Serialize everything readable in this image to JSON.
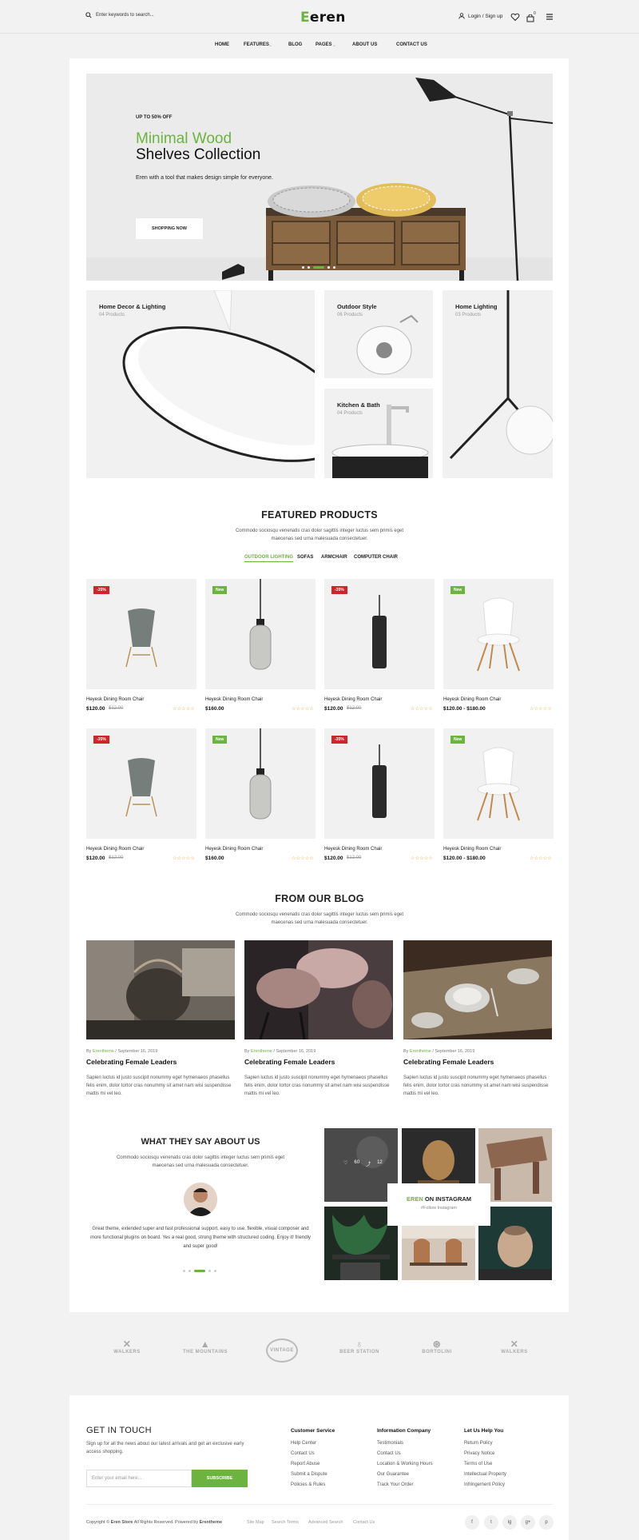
{
  "header": {
    "search_placeholder": "Enter keywords to search...",
    "logo": "eren",
    "logo_initial": "E",
    "login": "Login / Sign up",
    "cart_count": "0"
  },
  "nav": [
    "HOME",
    "FEATURES",
    "BLOG",
    "PAGES",
    "ABOUT US",
    "CONTACT US"
  ],
  "hero": {
    "kicker": "UP TO 50% OFF",
    "title_line1": "Minimal Wood",
    "title_line2": "Shelves Collection",
    "subtitle": "Eren with a tool that makes design simple for everyone.",
    "button": "SHOPPING NOW",
    "slides_active": 3
  },
  "categories": [
    {
      "title": "Home Decor & Lighting",
      "count": "04 Products"
    },
    {
      "title": "Outdoor Style",
      "count": "06 Products"
    },
    {
      "title": "Home Lighting",
      "count": "03 Products"
    },
    {
      "title": "Kitchen & Bath",
      "count": "04 Products"
    }
  ],
  "featured": {
    "title": "FEATURED PRODUCTS",
    "subtitle": "Commodo sociosqu venenatis cras dolor sagittis integer luctus sem primis eget maecenas sed urna malesuada consectetuer.",
    "tabs": [
      "OUTDOOR LIGHTING",
      "SOFAS",
      "ARMCHAIR",
      "COMPUTER CHAIR"
    ],
    "products": [
      {
        "name": "Heyesk Dining Room Chair",
        "price": "$120.00",
        "old": "$12.00",
        "badge": "-35%"
      },
      {
        "name": "Heyesk Dining Room Chair",
        "price": "$160.00",
        "old": "",
        "badge": "New"
      },
      {
        "name": "Heyesk Dining Room Chair",
        "price": "$120.00",
        "old": "$12.00",
        "badge": "-35%"
      },
      {
        "name": "Heyesk Dining Room Chair",
        "price": "$120.00 - $180.00",
        "old": "",
        "badge": "New"
      },
      {
        "name": "Heyesk Dining Room Chair",
        "price": "$120.00",
        "old": "$12.00",
        "badge": "-35%"
      },
      {
        "name": "Heyesk Dining Room Chair",
        "price": "$160.00",
        "old": "",
        "badge": "New"
      },
      {
        "name": "Heyesk Dining Room Chair",
        "price": "$120.00",
        "old": "$12.00",
        "badge": "-35%"
      },
      {
        "name": "Heyesk Dining Room Chair",
        "price": "$120.00 - $180.00",
        "old": "",
        "badge": "New"
      }
    ],
    "stars": "☆☆☆☆☆"
  },
  "blog": {
    "title": "FROM OUR BLOG",
    "subtitle": "Commodo sociosqu venenatis cras dolor sagittis integer luctus sem primis eget maecenas sed urna malesuada consectetuer.",
    "posts": [
      {
        "by": "By ",
        "author": "Erentheme",
        "date": " / September 16, 2019",
        "title": "Celebrating Female Leaders",
        "excerpt": "Sapien luctus id justo suscipit nonummy eget hymenaeos phasellus felis enim, dolor tortor cras nonummy sit amet nam wisi suspendisse mattis mi vel leo."
      },
      {
        "by": "By ",
        "author": "Erentheme",
        "date": " / September 16, 2019",
        "title": "Celebrating Female Leaders",
        "excerpt": "Sapien luctus id justo suscipit nonummy eget hymenaeos phasellus felis enim, dolor tortor cras nonummy sit amet nam wisi suspendisse mattis mi vel leo."
      },
      {
        "by": "By ",
        "author": "Erentheme",
        "date": " / September 16, 2019",
        "title": "Celebrating Female Leaders",
        "excerpt": "Sapien luctus id justo suscipit nonummy eget hymenaeos phasellus felis enim, dolor tortor cras nonummy sit amet nam wisi suspendisse mattis mi vel leo."
      }
    ]
  },
  "testimonial": {
    "title": "WHAT THEY SAY ABOUT US",
    "subtitle": "Commodo sociosqu venenatis cras dolor sagittis integer luctus sem primis eget maecenas sed urna malesuada consectetuer.",
    "quote": "Great theme, extended super and fast professional support, easy to use, flexible, visual composer and more functional plugins on board. Yes a real good, strong theme with structured coding. Enjoy it! friendly and super good!"
  },
  "instagram": {
    "brand": "EREN",
    "title_rest": " ON INSTAGRAM",
    "follow": "#Follow Instagram",
    "likes": "60",
    "shares": "12"
  },
  "brands": [
    "WALKERS",
    "THE MOUNTAINS",
    "VINTAGE",
    "BEER STATION",
    "BORTOLINI",
    "WALKERS"
  ],
  "footer": {
    "get_in_touch": "GET IN TOUCH",
    "signup_text": "Sign up for all the news about our latest arrivals and get an exclusive early access shopping.",
    "email_placeholder": "Enter your email here...",
    "subscribe": "SUBSCRIBE",
    "columns": [
      {
        "title": "Customer Service",
        "links": [
          "Help Center",
          "Contact Us",
          "Report Abuse",
          "Submit a Dispute",
          "Policies & Rules"
        ]
      },
      {
        "title": "Information Company",
        "links": [
          "Testimonials",
          "Contact Us",
          "Location & Working Hours",
          "Our Guarantee",
          "Track Your Order"
        ]
      },
      {
        "title": "Let Us Help You",
        "links": [
          "Return Policy",
          "Privacy Notice",
          "Terms of Use",
          "Intellectual Property",
          "Infringement Policy"
        ]
      }
    ],
    "copyright_pre": "Copyright © ",
    "copyright_store": "Eren Store",
    "copyright_mid": " All Rights Reserved. Powered by ",
    "copyright_brand": "Erentheme",
    "bottom_links": [
      "Site Map",
      "Search Terms",
      "Advanced Search",
      "Contact Us"
    ],
    "social": [
      "f",
      "t",
      "ig",
      "g+",
      "p"
    ]
  },
  "colors": {
    "accent": "#6db33f",
    "sale": "#d0242a"
  }
}
